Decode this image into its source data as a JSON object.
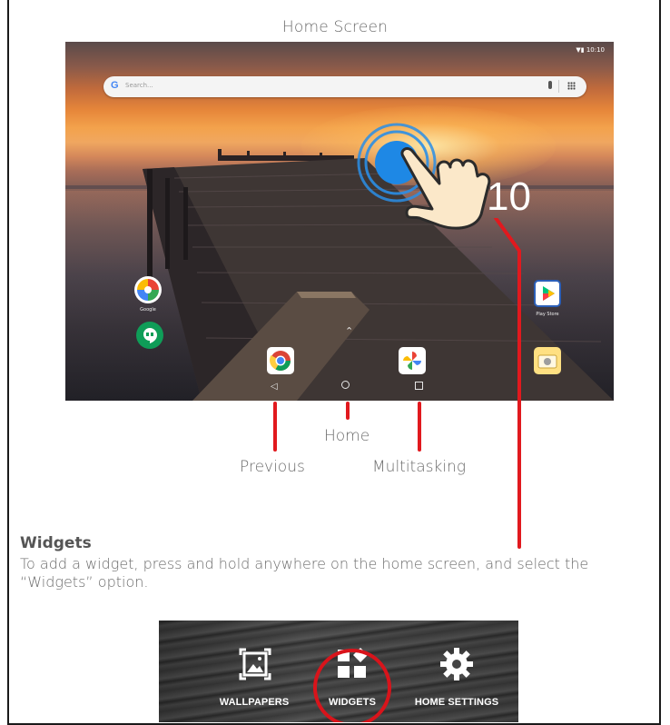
{
  "screen_title": "Home Screen",
  "tablet": {
    "status_text": "▼▮ 10:10",
    "search_placeholder": "Search...",
    "search_logo": "G",
    "clock_digit": "10",
    "apps": {
      "google_folder_label": "Google",
      "play_store_label": "Play Store"
    }
  },
  "nav_labels": {
    "previous": "Previous",
    "home": "Home",
    "multitasking": "Multitasking"
  },
  "widgets_section": {
    "heading": "Widgets",
    "description": "To add a widget, press and hold anywhere on the home screen, and select the “Widgets” option."
  },
  "menu": {
    "wallpapers": "WALLPAPERS",
    "widgets": "WIDGETS",
    "home_settings": "HOME SETTINGS"
  },
  "colors": {
    "accent_red": "#e1191e",
    "touch_blue": "#1e88e5"
  }
}
